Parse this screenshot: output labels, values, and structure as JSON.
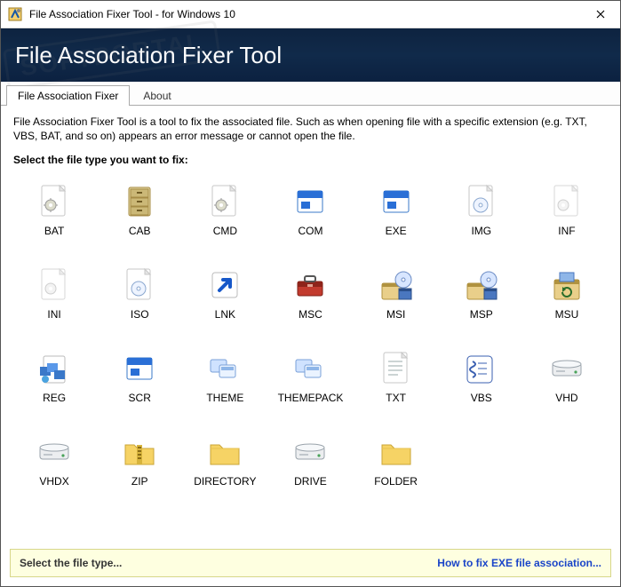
{
  "window": {
    "title": "File Association Fixer Tool - for Windows 10"
  },
  "banner": {
    "heading": "File Association Fixer Tool"
  },
  "tabs": {
    "items": [
      {
        "label": "File Association Fixer",
        "active": true
      },
      {
        "label": "About",
        "active": false
      }
    ]
  },
  "main": {
    "description": "File Association Fixer Tool is a tool to fix the associated file. Such as when opening file with a specific extension (e.g. TXT, VBS, BAT, and so on) appears an error message or cannot open the file.",
    "prompt": "Select the file type you want to fix:"
  },
  "types": [
    {
      "label": "BAT",
      "icon": "gear-page"
    },
    {
      "label": "CAB",
      "icon": "cabinet"
    },
    {
      "label": "CMD",
      "icon": "gear-page"
    },
    {
      "label": "COM",
      "icon": "window-blue"
    },
    {
      "label": "EXE",
      "icon": "window-blue"
    },
    {
      "label": "IMG",
      "icon": "disc-page"
    },
    {
      "label": "INF",
      "icon": "gear-page-faded"
    },
    {
      "label": "INI",
      "icon": "gear-page-faded"
    },
    {
      "label": "ISO",
      "icon": "disc-page"
    },
    {
      "label": "LNK",
      "icon": "shortcut"
    },
    {
      "label": "MSC",
      "icon": "toolbox"
    },
    {
      "label": "MSI",
      "icon": "installer"
    },
    {
      "label": "MSP",
      "icon": "installer"
    },
    {
      "label": "MSU",
      "icon": "update-box"
    },
    {
      "label": "REG",
      "icon": "registry"
    },
    {
      "label": "SCR",
      "icon": "window-blue"
    },
    {
      "label": "THEME",
      "icon": "theme"
    },
    {
      "label": "THEMEPACK",
      "icon": "theme"
    },
    {
      "label": "TXT",
      "icon": "text-page"
    },
    {
      "label": "VBS",
      "icon": "script"
    },
    {
      "label": "VHD",
      "icon": "drive"
    },
    {
      "label": "VHDX",
      "icon": "drive"
    },
    {
      "label": "ZIP",
      "icon": "zip"
    },
    {
      "label": "DIRECTORY",
      "icon": "folder"
    },
    {
      "label": "DRIVE",
      "icon": "drive"
    },
    {
      "label": "FOLDER",
      "icon": "folder"
    }
  ],
  "status": {
    "left": "Select the file type...",
    "right": "How to fix EXE file association..."
  },
  "watermark": "SOFTPORTAL"
}
